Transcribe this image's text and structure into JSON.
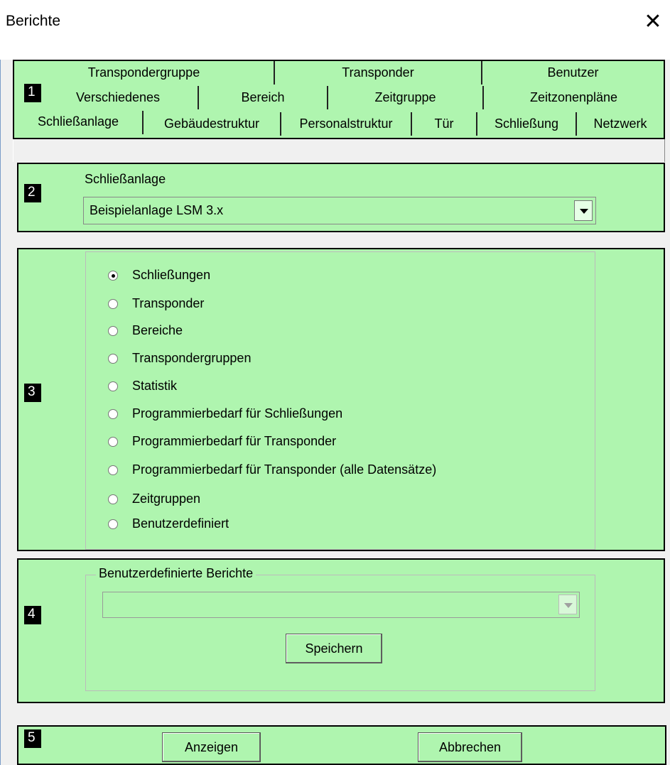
{
  "window": {
    "title": "Berichte"
  },
  "tabs": {
    "row1": [
      "Transpondergruppe",
      "Transponder",
      "Benutzer"
    ],
    "row2": [
      "Verschiedenes",
      "Bereich",
      "Zeitgruppe",
      "Zeitzonenpläne"
    ],
    "row3": [
      "Schließanlage",
      "Gebäudestruktur",
      "Personalstruktur",
      "Tür",
      "Schließung",
      "Netzwerk"
    ],
    "active": "Schließanlage"
  },
  "markers": [
    "1",
    "2",
    "3",
    "4",
    "5"
  ],
  "schliessanlage": {
    "label": "Schließanlage",
    "selected": "Beispielanlage LSM 3.x"
  },
  "reports": {
    "options": [
      "Schließungen",
      "Transponder",
      "Bereiche",
      "Transpondergruppen",
      "Statistik",
      "Programmierbedarf für Schließungen",
      "Programmierbedarf für Transponder",
      "Programmierbedarf für Transponder (alle Datensätze)",
      "Zeitgruppen",
      "Benutzerdefiniert"
    ],
    "selected_index": 0
  },
  "custom": {
    "legend": "Benutzerdefinierte Berichte",
    "value": "",
    "save_label": "Speichern"
  },
  "footer": {
    "show_label": "Anzeigen",
    "cancel_label": "Abbrechen"
  },
  "colors": {
    "panel": "#aff5af",
    "outline": "#000000"
  }
}
